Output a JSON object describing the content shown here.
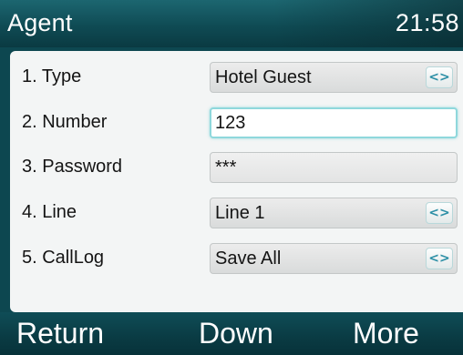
{
  "header": {
    "title": "Agent",
    "time": "21:58"
  },
  "form": {
    "rows": [
      {
        "label": "1.  Type",
        "value": "Hotel Guest",
        "kind": "select",
        "selector_icon": "left-right-arrows-icon",
        "arrow_glyph": "<>"
      },
      {
        "label": "2.  Number",
        "value": "123",
        "kind": "text",
        "focused": true
      },
      {
        "label": "3.  Password",
        "value": "***",
        "kind": "password"
      },
      {
        "label": "4.  Line",
        "value": "Line 1",
        "kind": "select",
        "selector_icon": "left-right-arrows-icon",
        "arrow_glyph": "<>"
      },
      {
        "label": "5.  CallLog",
        "value": "Save All",
        "kind": "select",
        "selector_icon": "left-right-arrows-icon",
        "arrow_glyph": "<>"
      }
    ]
  },
  "softkeys": {
    "return_label": "Return",
    "down_label": "Down",
    "more_label": "More"
  },
  "colors": {
    "title_bar": "#0f4b54",
    "panel_background": "#f3f5f5",
    "focus_border": "#8fd8dc",
    "arrow_icon": "#2c8fa6",
    "text": "#141414"
  }
}
